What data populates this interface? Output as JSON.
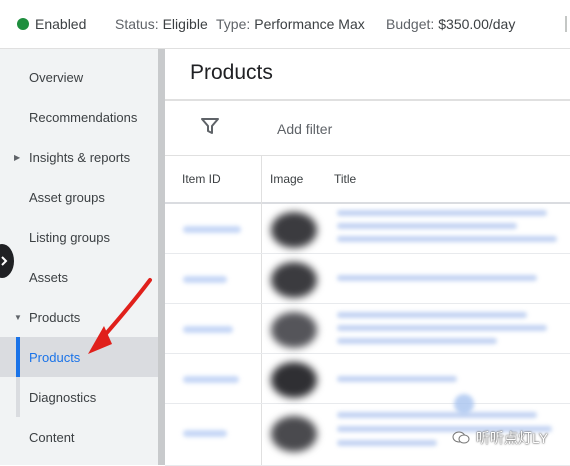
{
  "status_bar": {
    "enabled": "Enabled",
    "status_label": "Status:",
    "status_value": "Eligible",
    "type_label": "Type:",
    "type_value": "Performance Max",
    "budget_label": "Budget:",
    "budget_value": "$350.00/day"
  },
  "sidebar": {
    "items": [
      {
        "label": "Overview"
      },
      {
        "label": "Recommendations"
      },
      {
        "label": "Insights & reports"
      },
      {
        "label": "Asset groups"
      },
      {
        "label": "Listing groups"
      },
      {
        "label": "Assets"
      },
      {
        "label": "Products"
      },
      {
        "label": "Products"
      },
      {
        "label": "Diagnostics"
      },
      {
        "label": "Content"
      }
    ]
  },
  "main": {
    "title": "Products",
    "add_filter": "Add filter",
    "columns": [
      "Item ID",
      "Image",
      "Title"
    ]
  },
  "watermark": "听听点灯LY",
  "colors": {
    "accent": "#1a73e8",
    "enabled_dot": "#1e8e3e",
    "arrow": "#e0201b"
  }
}
